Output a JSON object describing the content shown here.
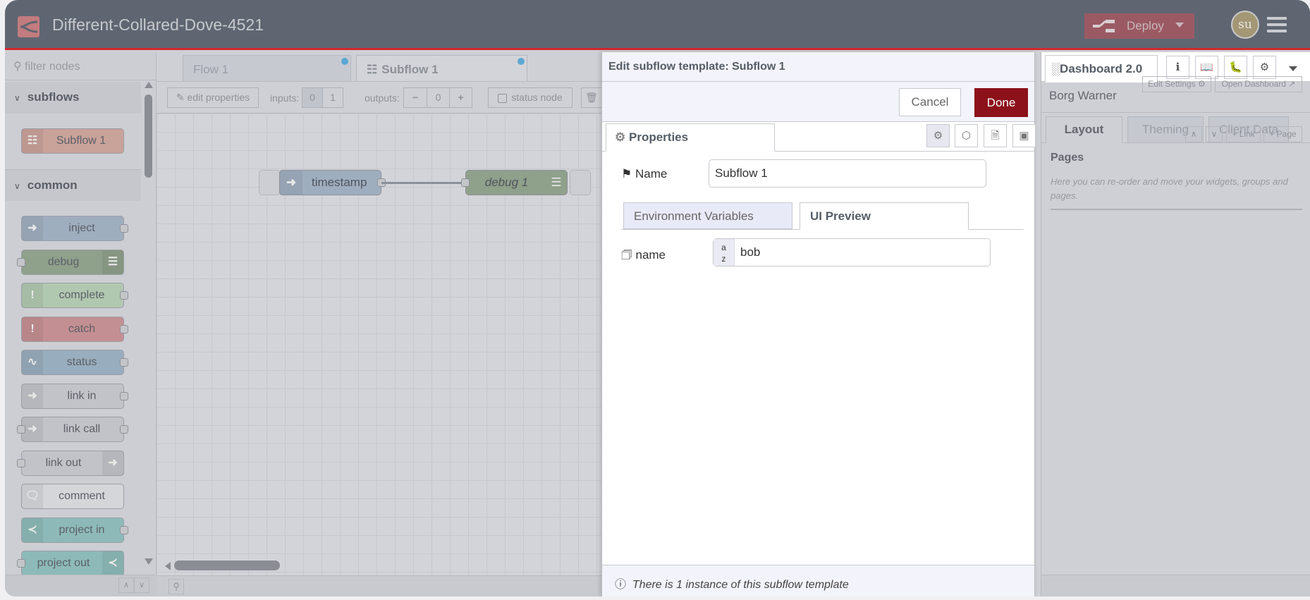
{
  "header": {
    "title": "Different-Collared-Dove-4521",
    "deploy_label": "Deploy",
    "avatar": "su",
    "brand_color": "#c27b7e",
    "deploy_color": "#9b5a63"
  },
  "palette": {
    "filter_placeholder": "filter nodes",
    "categories": [
      {
        "label": "subflows"
      },
      {
        "label": "common"
      }
    ],
    "subflow_nodes": [
      {
        "label": "Subflow 1",
        "color": "#c9a29a"
      }
    ],
    "nodes": [
      {
        "label": "inject",
        "color": "#9faebf"
      },
      {
        "label": "debug",
        "color": "#8fa08b"
      },
      {
        "label": "complete",
        "color": "#b1c8b0"
      },
      {
        "label": "catch",
        "color": "#c48f92"
      },
      {
        "label": "status",
        "color": "#98adbd"
      },
      {
        "label": "link in",
        "color": "#c2c3c8"
      },
      {
        "label": "link call",
        "color": "#c2c3c8"
      },
      {
        "label": "link out",
        "color": "#c2c3c8"
      },
      {
        "label": "comment",
        "color": "#d5d6da"
      },
      {
        "label": "project in",
        "color": "#8dbab8"
      },
      {
        "label": "project out",
        "color": "#8dbab8"
      }
    ]
  },
  "workspace": {
    "tabs": [
      {
        "label": "Flow 1"
      },
      {
        "label": "Subflow 1",
        "active": true
      }
    ],
    "toolbar": {
      "edit_properties": "edit properties",
      "inputs_label": "inputs:",
      "inputs_options": [
        "0",
        "1"
      ],
      "outputs_label": "outputs:",
      "outputs_value": "0",
      "status_node": "status node"
    },
    "flow_nodes": [
      {
        "label": "timestamp",
        "type": "inject"
      },
      {
        "label": "debug 1",
        "type": "debug"
      }
    ]
  },
  "tray": {
    "title": "Edit subflow template: Subflow 1",
    "cancel": "Cancel",
    "done": "Done",
    "done_color": "#8c111b",
    "tab_properties": "Properties",
    "name_label": "Name",
    "name_value": "Subflow 1",
    "subtabs": [
      "Environment Variables",
      "UI Preview"
    ],
    "env": {
      "label": "name",
      "type": "az",
      "value": "bob"
    },
    "footer": "There is 1 instance of this subflow template"
  },
  "sidebar": {
    "tab": "Dashboard 2.0",
    "dashboard_name": "Borg Warner",
    "edit_settings": "Edit Settings",
    "open_dashboard": "Open Dashboard",
    "tabs": [
      "Layout",
      "Theming",
      "Client Data"
    ],
    "pages_title": "Pages",
    "link_btn": "Link",
    "page_btn": "Page",
    "hint": "Here you can re-order and move your widgets, groups and pages."
  }
}
